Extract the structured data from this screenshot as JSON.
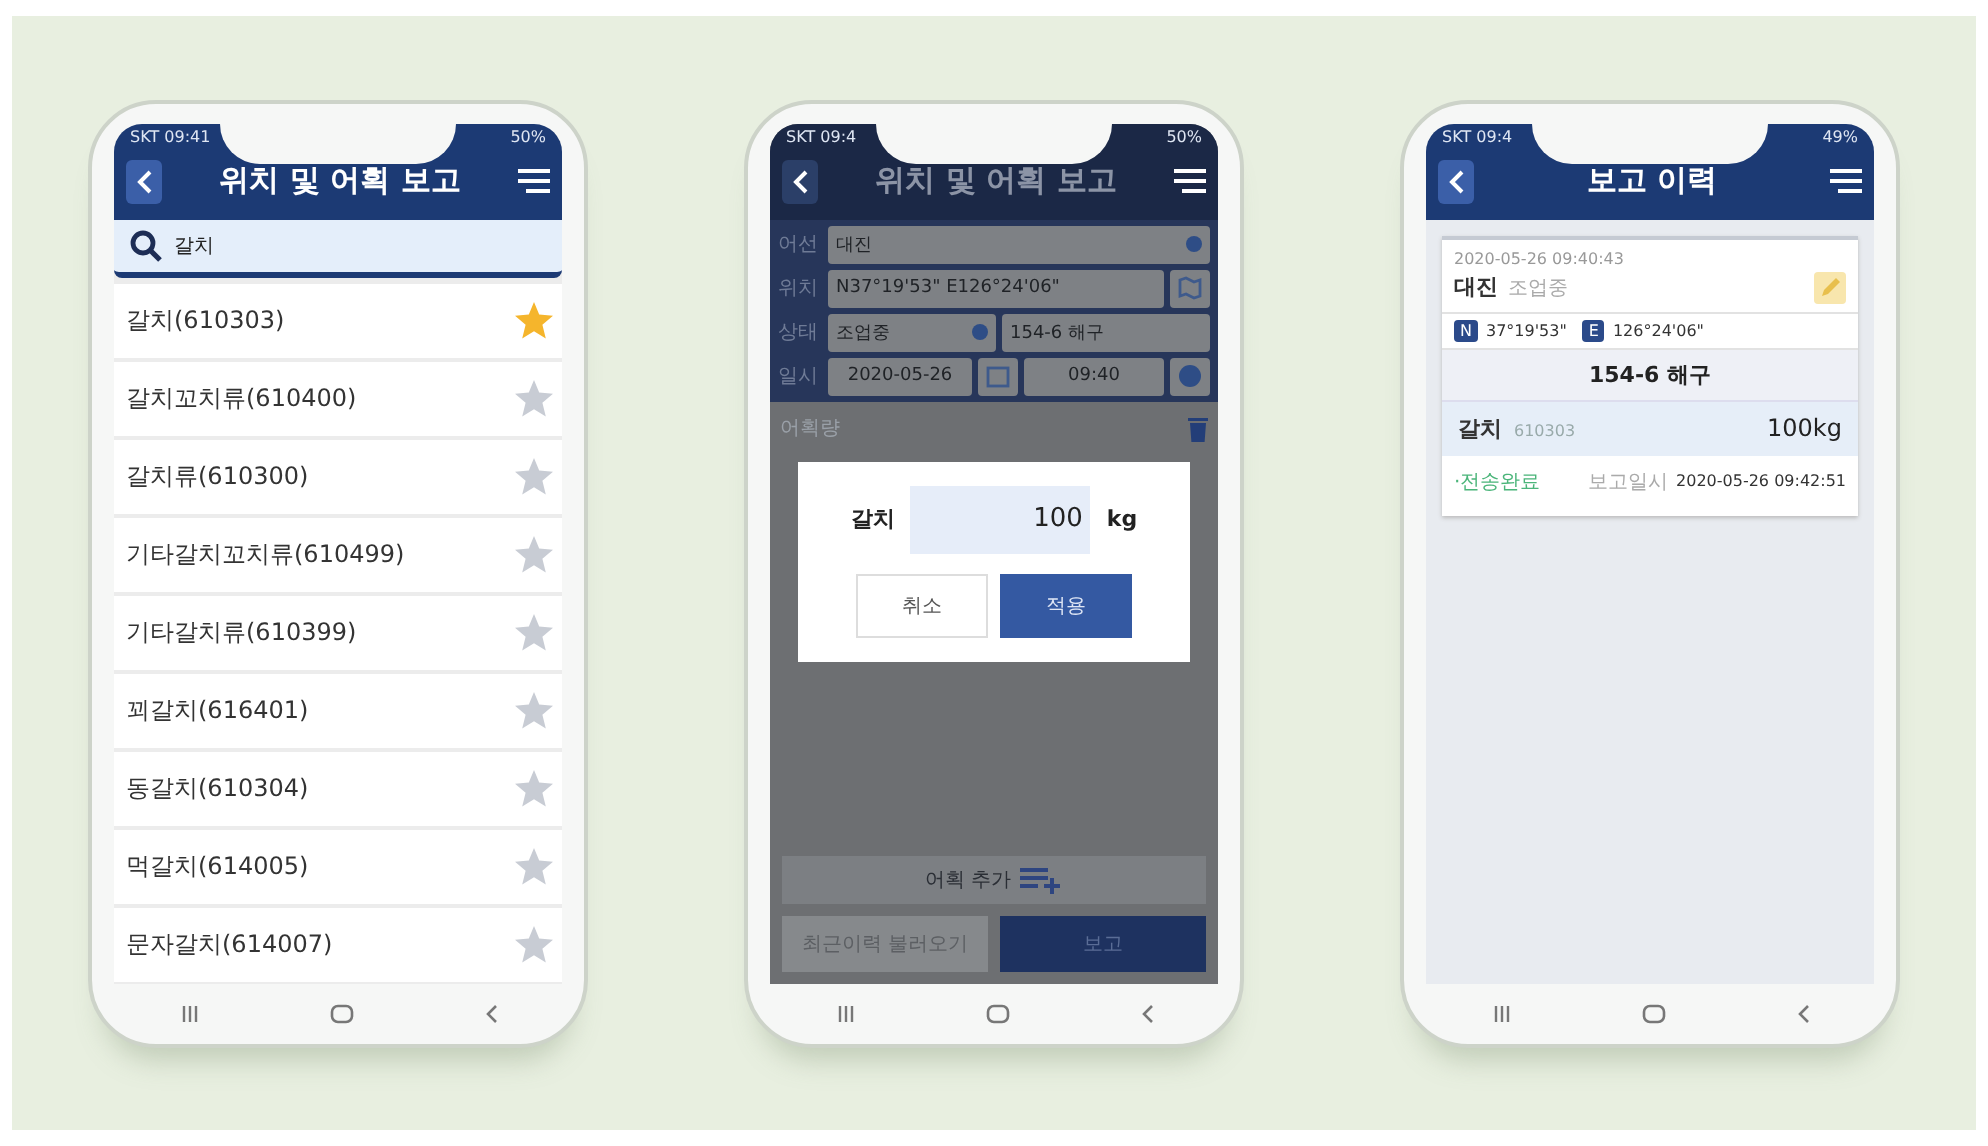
{
  "search_screen": {
    "status": {
      "time": "SKT 09:41",
      "battery": "50%"
    },
    "header": {
      "title": "위치 및 어획 보고"
    },
    "search": {
      "value": "갈치"
    },
    "items": [
      {
        "label": "갈치(610303)",
        "starred": true
      },
      {
        "label": "갈치꼬치류(610400)",
        "starred": false
      },
      {
        "label": "갈치류(610300)",
        "starred": false
      },
      {
        "label": "기타갈치꼬치류(610499)",
        "starred": false
      },
      {
        "label": "기타갈치류(610399)",
        "starred": false
      },
      {
        "label": "꾀갈치(616401)",
        "starred": false
      },
      {
        "label": "동갈치(610304)",
        "starred": false
      },
      {
        "label": "먹갈치(614005)",
        "starred": false
      },
      {
        "label": "문자갈치(614007)",
        "starred": false
      }
    ]
  },
  "report_screen": {
    "status": {
      "time": "SKT 09:4",
      "battery": "50%"
    },
    "header": {
      "title": "위치 및 어획 보고"
    },
    "form": {
      "vessel": {
        "label": "어선",
        "value": "대진"
      },
      "position": {
        "label": "위치",
        "value": "N37°19'53\" E126°24'06\""
      },
      "state": {
        "label": "상태",
        "value": "조업중",
        "zone": "154-6 해구"
      },
      "datetime": {
        "label": "일시",
        "date": "2020-05-26",
        "time": "09:40"
      }
    },
    "catch_title": "어획량",
    "dialog": {
      "fish": "갈치",
      "amount": "100",
      "unit": "kg",
      "buttons": [
        {
          "label": "취소",
          "kind": "secondary"
        },
        {
          "label": "적용",
          "kind": "primary"
        }
      ]
    },
    "add_button": "어획 추가",
    "footer_buttons": [
      {
        "label": "최근이력 불러오기",
        "kind": "secondary"
      },
      {
        "label": "보고",
        "kind": "primary"
      }
    ]
  },
  "history_screen": {
    "status": {
      "time": "SKT 09:4",
      "battery": "49%"
    },
    "header": {
      "title": "보고 이력"
    },
    "card": {
      "created": "2020-05-26 09:40:43",
      "vessel": "대진",
      "vessel_state": "조업중",
      "lat_tag": "N",
      "lat": "37°19'53\"",
      "lon_tag": "E",
      "lon": "126°24'06\"",
      "zone": "154-6 해구",
      "fish": "갈치",
      "fish_code": "610303",
      "weight": "100kg",
      "sent_state": "·전송완료",
      "report_label": "보고일시",
      "report_time": "2020-05-26 09:42:51"
    }
  }
}
